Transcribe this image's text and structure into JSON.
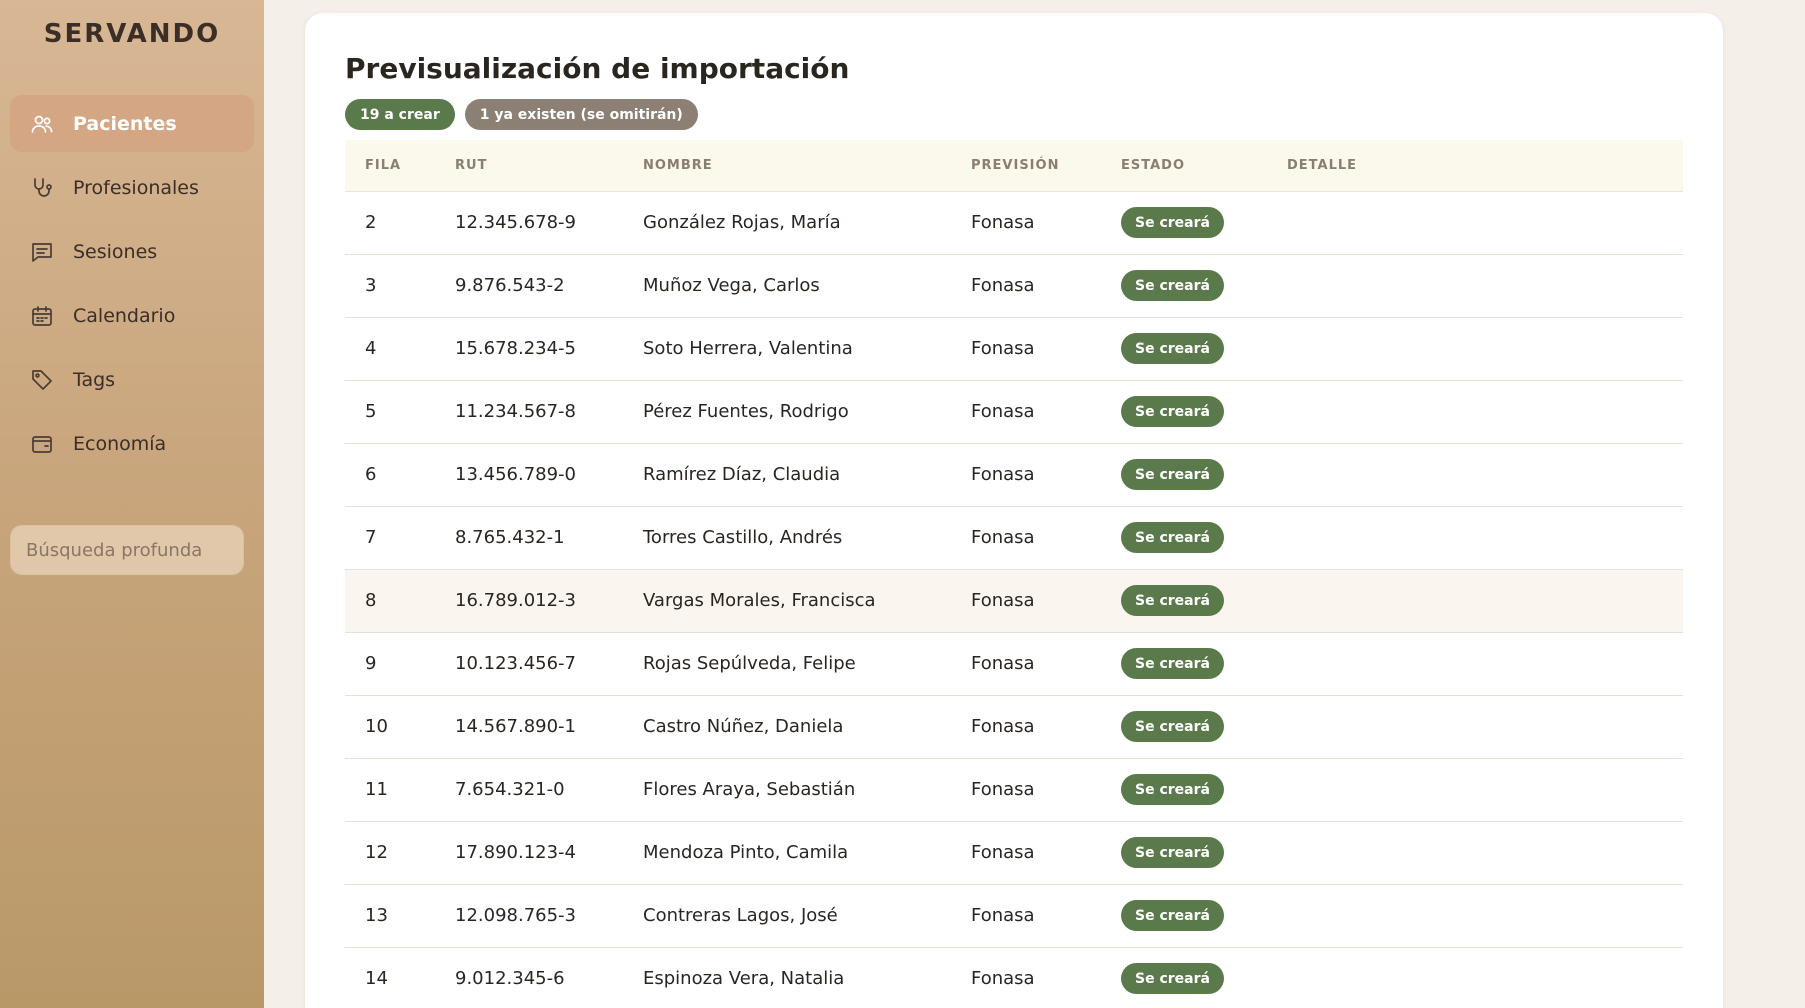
{
  "app": {
    "brand": "SERVANDO"
  },
  "sidebar": {
    "items": [
      {
        "label": "Pacientes",
        "icon": "users-icon",
        "active": true
      },
      {
        "label": "Profesionales",
        "icon": "stethoscope-icon",
        "active": false
      },
      {
        "label": "Sesiones",
        "icon": "message-square-icon",
        "active": false
      },
      {
        "label": "Calendario",
        "icon": "calendar-icon",
        "active": false
      },
      {
        "label": "Tags",
        "icon": "tag-icon",
        "active": false
      },
      {
        "label": "Economía",
        "icon": "wallet-icon",
        "active": false
      }
    ],
    "search": {
      "placeholder": "Búsqueda profunda",
      "value": ""
    }
  },
  "main": {
    "title": "Previsualización de importación",
    "badges": {
      "create": "19 a crear",
      "exists": "1 ya existen (se omitirán)"
    },
    "table": {
      "headers": {
        "fila": "FILA",
        "rut": "RUT",
        "nombre": "NOMBRE",
        "prevision": "PREVISIÓN",
        "estado": "ESTADO",
        "detalle": "DETALLE"
      },
      "rows": [
        {
          "fila": "2",
          "rut": "12.345.678-9",
          "nombre": "González Rojas, María",
          "prevision": "Fonasa",
          "estado": "Se creará",
          "detalle": ""
        },
        {
          "fila": "3",
          "rut": "9.876.543-2",
          "nombre": "Muñoz Vega, Carlos",
          "prevision": "Fonasa",
          "estado": "Se creará",
          "detalle": ""
        },
        {
          "fila": "4",
          "rut": "15.678.234-5",
          "nombre": "Soto Herrera, Valentina",
          "prevision": "Fonasa",
          "estado": "Se creará",
          "detalle": ""
        },
        {
          "fila": "5",
          "rut": "11.234.567-8",
          "nombre": "Pérez Fuentes, Rodrigo",
          "prevision": "Fonasa",
          "estado": "Se creará",
          "detalle": ""
        },
        {
          "fila": "6",
          "rut": "13.456.789-0",
          "nombre": "Ramírez Díaz, Claudia",
          "prevision": "Fonasa",
          "estado": "Se creará",
          "detalle": ""
        },
        {
          "fila": "7",
          "rut": "8.765.432-1",
          "nombre": "Torres Castillo, Andrés",
          "prevision": "Fonasa",
          "estado": "Se creará",
          "detalle": ""
        },
        {
          "fila": "8",
          "rut": "16.789.012-3",
          "nombre": "Vargas Morales, Francisca",
          "prevision": "Fonasa",
          "estado": "Se creará",
          "detalle": ""
        },
        {
          "fila": "9",
          "rut": "10.123.456-7",
          "nombre": "Rojas Sepúlveda, Felipe",
          "prevision": "Fonasa",
          "estado": "Se creará",
          "detalle": ""
        },
        {
          "fila": "10",
          "rut": "14.567.890-1",
          "nombre": "Castro Núñez, Daniela",
          "prevision": "Fonasa",
          "estado": "Se creará",
          "detalle": ""
        },
        {
          "fila": "11",
          "rut": "7.654.321-0",
          "nombre": "Flores Araya, Sebastián",
          "prevision": "Fonasa",
          "estado": "Se creará",
          "detalle": ""
        },
        {
          "fila": "12",
          "rut": "17.890.123-4",
          "nombre": "Mendoza Pinto, Camila",
          "prevision": "Fonasa",
          "estado": "Se creará",
          "detalle": ""
        },
        {
          "fila": "13",
          "rut": "12.098.765-3",
          "nombre": "Contreras Lagos, José",
          "prevision": "Fonasa",
          "estado": "Se creará",
          "detalle": ""
        },
        {
          "fila": "14",
          "rut": "9.012.345-6",
          "nombre": "Espinoza Vera, Natalia",
          "prevision": "Fonasa",
          "estado": "Se creará",
          "detalle": ""
        }
      ]
    }
  },
  "colors": {
    "sidebar_top": "#d8b795",
    "sidebar_bottom": "#b99868",
    "active_nav": "#d4a684",
    "badge_create": "#5a7a4b",
    "badge_exists": "#8c7f74",
    "status_create": "#5a7a4b",
    "table_header_bg": "#fbf8ec"
  }
}
